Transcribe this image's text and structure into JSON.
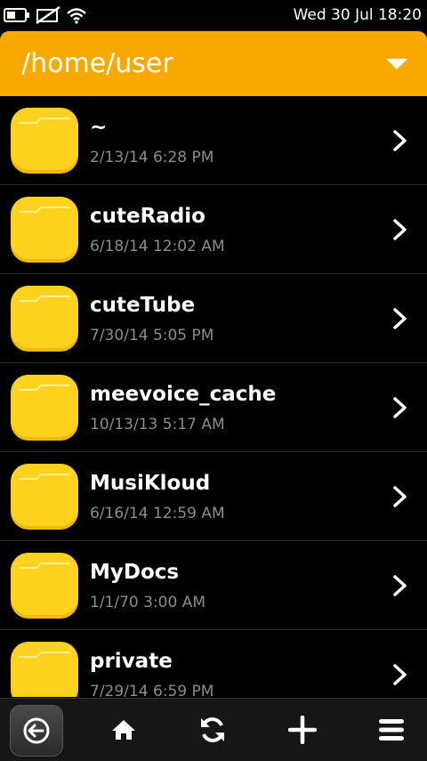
{
  "status_bar": {
    "datetime": "Wed 30 Jul 18:20",
    "icons": [
      "battery-icon",
      "signal-off-icon",
      "wifi-icon"
    ]
  },
  "header": {
    "path": "/home/user",
    "icon": "chevron-down-icon",
    "accent_color": "#f7a900"
  },
  "files": [
    {
      "name": "~",
      "date": "2/13/14 6:28 PM"
    },
    {
      "name": "cuteRadio",
      "date": "6/18/14 12:02 AM"
    },
    {
      "name": "cuteTube",
      "date": "7/30/14 5:05 PM"
    },
    {
      "name": "meevoice_cache",
      "date": "10/13/13 5:17 AM"
    },
    {
      "name": "MusiKloud",
      "date": "6/16/14 12:59 AM"
    },
    {
      "name": "MyDocs",
      "date": "1/1/70 3:00 AM"
    },
    {
      "name": "private",
      "date": "7/29/14 6:59 PM"
    }
  ],
  "toolbar": {
    "buttons": [
      "back-icon",
      "home-icon",
      "refresh-icon",
      "add-icon",
      "menu-icon"
    ]
  },
  "folder_color": "#ffd21f"
}
